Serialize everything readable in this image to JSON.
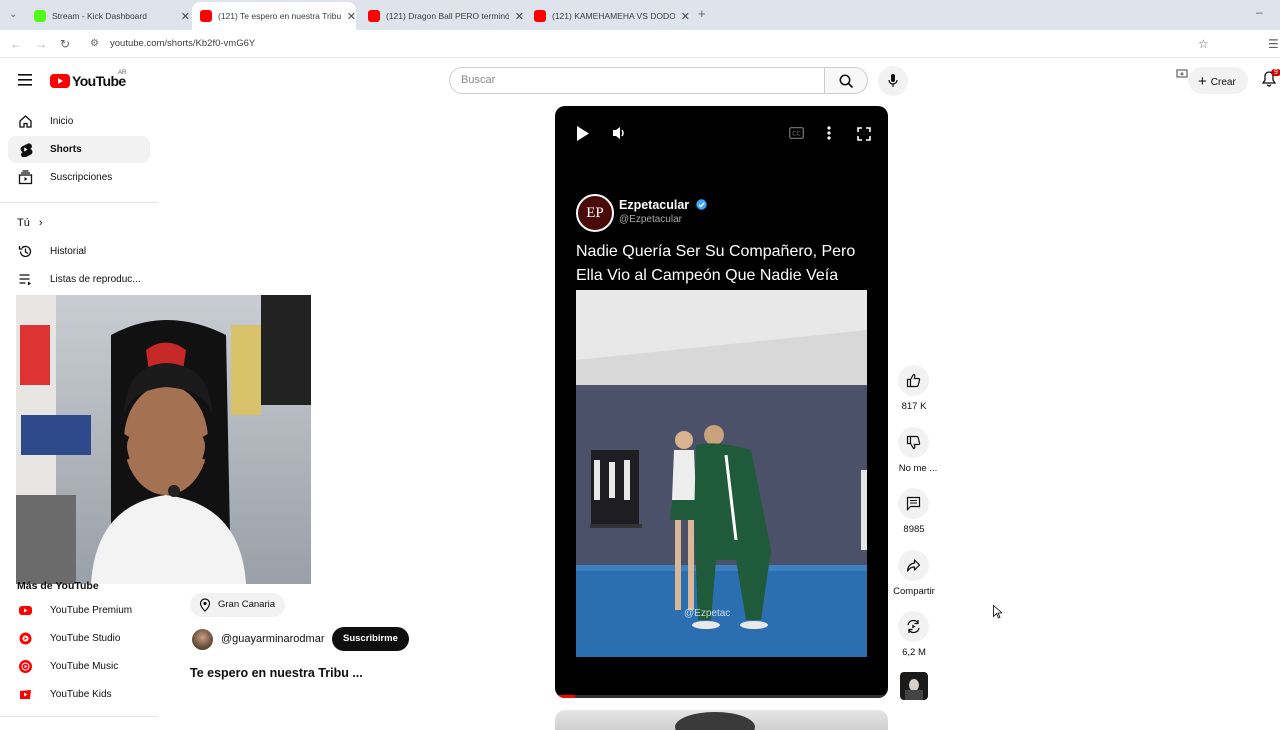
{
  "browser": {
    "tabs": [
      {
        "title": "Stream - Kick Dashboard",
        "favicon_color": "#53fc18",
        "active": false
      },
      {
        "title": "(121) Te espero en nuestra Tribu",
        "favicon_color": "#ff0000",
        "active": true
      },
      {
        "title": "(121) Dragon Ball PERO terminó",
        "favicon_color": "#ff0000",
        "active": false
      },
      {
        "title": "(121) KAMEHAMEHA VS DODON",
        "favicon_color": "#ff0000",
        "active": false
      }
    ],
    "new_tab": "+",
    "url": "youtube.com/shorts/Kb2f0-vmG6Y"
  },
  "header": {
    "logo_text": "YouTube",
    "country_code": "AR",
    "search_placeholder": "Buscar",
    "create_label": "Crear",
    "notification_count": "9"
  },
  "sidebar": {
    "items": [
      {
        "label": "Inicio",
        "icon": "home-icon"
      },
      {
        "label": "Shorts",
        "icon": "shorts-icon",
        "active": true
      },
      {
        "label": "Suscripciones",
        "icon": "subscriptions-icon"
      }
    ],
    "you_label": "Tú",
    "you_items": [
      {
        "label": "Historial",
        "icon": "history-icon"
      },
      {
        "label": "Listas de reproduc...",
        "icon": "playlists-icon"
      }
    ],
    "more_heading": "Más de YouTube",
    "more_items": [
      {
        "label": "YouTube Premium",
        "icon": "youtube-premium-icon"
      },
      {
        "label": "YouTube Studio",
        "icon": "youtube-studio-icon"
      },
      {
        "label": "YouTube Music",
        "icon": "youtube-music-icon"
      },
      {
        "label": "YouTube Kids",
        "icon": "youtube-kids-icon"
      }
    ]
  },
  "short_info": {
    "location": "Gran Canaria",
    "channel": "@guayarminarodmar",
    "subscribe_label": "Suscribirme",
    "title": "Te espero en nuestra Tribu ..."
  },
  "video": {
    "tweet_name": "Ezpetacular",
    "tweet_handle": "@Ezpetacular",
    "avatar_text": "EP",
    "caption": "Nadie Quería Ser Su Compañero, Pero Ella Vio al Campeón Que Nadie Veía",
    "watermark": "@Ezpetac"
  },
  "actions": {
    "likes": "817 K",
    "dislike": "No me ...",
    "comments": "8985",
    "share": "Compartir",
    "remix": "6,2 M"
  },
  "colors": {
    "youtube_red": "#ff0000",
    "subscribe_bg": "#0f0f0f",
    "verified_blue": "#3ea6ff"
  }
}
